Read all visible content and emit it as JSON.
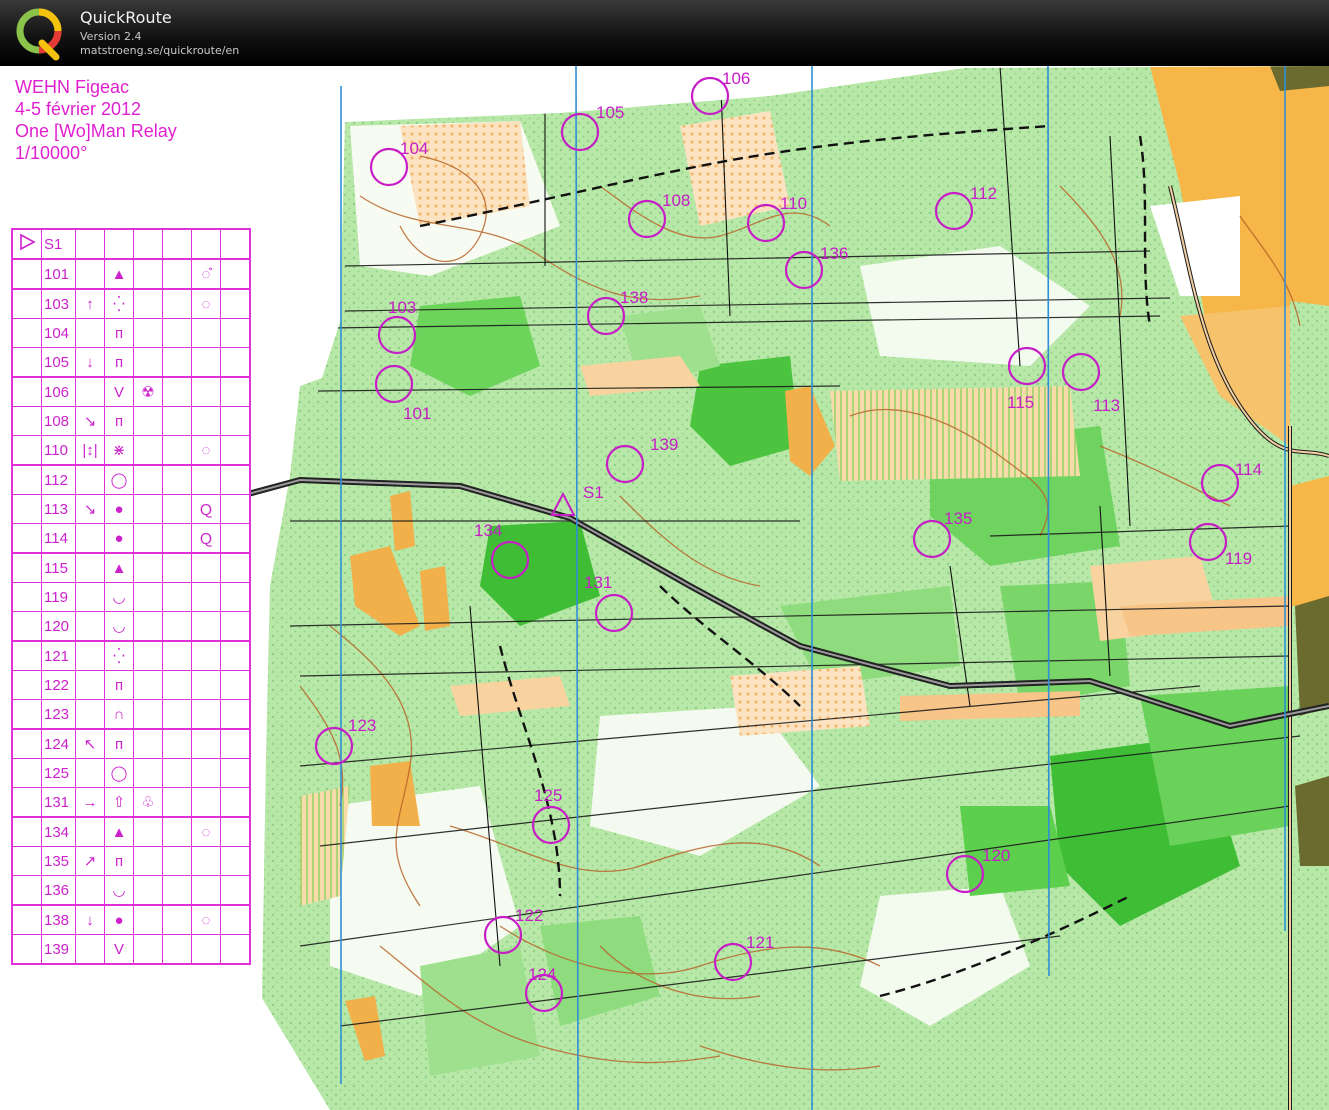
{
  "app": {
    "name": "QuickRoute",
    "version": "Version 2.4",
    "url": "matstroeng.se/quickroute/en"
  },
  "event": {
    "title": "WEHN Figeac",
    "dates": "4-5 février 2012",
    "race": "One [Wo]Man Relay",
    "scale": "1/10000°"
  },
  "colors": {
    "course": "#c71dc7",
    "meridian": "#2f8fd6",
    "vegetation_green": "#5ccf4c",
    "open_land": "#f6c587",
    "road": "#3a2a1a",
    "contour": "#b9652a"
  },
  "description_table": {
    "start_symbol": "start-triangle",
    "start_code": "S1",
    "rows": [
      {
        "code": "101",
        "dir": "",
        "feature": "▲",
        "extra": "",
        "pos": "◌̊"
      },
      {
        "code": "103",
        "dir": "↑",
        "feature": "⁛",
        "extra": "",
        "pos": "◌"
      },
      {
        "code": "104",
        "dir": "",
        "feature": "ᴨ",
        "extra": "",
        "pos": ""
      },
      {
        "code": "105",
        "dir": "↓",
        "feature": "ᴨ",
        "extra": "",
        "pos": ""
      },
      {
        "code": "106",
        "dir": "",
        "feature": "V",
        "extra": "☢",
        "pos": ""
      },
      {
        "code": "108",
        "dir": "↘",
        "feature": "ᴨ",
        "extra": "",
        "pos": ""
      },
      {
        "code": "110",
        "dir": "|↕|",
        "feature": "⋇",
        "extra": "",
        "pos": "◌"
      },
      {
        "code": "112",
        "dir": "",
        "feature": "◯",
        "extra": "",
        "pos": ""
      },
      {
        "code": "113",
        "dir": "↘",
        "feature": "●",
        "extra": "",
        "pos": "Ｑ"
      },
      {
        "code": "114",
        "dir": "",
        "feature": "●",
        "extra": "",
        "pos": "Ｑ"
      },
      {
        "code": "115",
        "dir": "",
        "feature": "▲",
        "extra": "",
        "pos": ""
      },
      {
        "code": "119",
        "dir": "",
        "feature": "◡",
        "extra": "",
        "pos": ""
      },
      {
        "code": "120",
        "dir": "",
        "feature": "◡",
        "extra": "",
        "pos": ""
      },
      {
        "code": "121",
        "dir": "",
        "feature": "⁛",
        "extra": "",
        "pos": ""
      },
      {
        "code": "122",
        "dir": "",
        "feature": "ᴨ",
        "extra": "",
        "pos": ""
      },
      {
        "code": "123",
        "dir": "",
        "feature": "∩",
        "extra": "",
        "pos": ""
      },
      {
        "code": "124",
        "dir": "↖",
        "feature": "ᴨ",
        "extra": "",
        "pos": ""
      },
      {
        "code": "125",
        "dir": "",
        "feature": "◯",
        "extra": "",
        "pos": ""
      },
      {
        "code": "131",
        "dir": "→",
        "feature": "⇧",
        "extra": "♧",
        "pos": ""
      },
      {
        "code": "134",
        "dir": "",
        "feature": "▲",
        "extra": "",
        "pos": "◌"
      },
      {
        "code": "135",
        "dir": "↗",
        "feature": "ᴨ",
        "extra": "",
        "pos": ""
      },
      {
        "code": "136",
        "dir": "",
        "feature": "◡",
        "extra": "",
        "pos": ""
      },
      {
        "code": "138",
        "dir": "↓",
        "feature": "●",
        "extra": "",
        "pos": "◌"
      },
      {
        "code": "139",
        "dir": "",
        "feature": "V",
        "extra": "",
        "pos": ""
      }
    ]
  },
  "controls": [
    {
      "code": "106"
    },
    {
      "code": "105"
    },
    {
      "code": "104"
    },
    {
      "code": "108"
    },
    {
      "code": "110"
    },
    {
      "code": "112"
    },
    {
      "code": "136"
    },
    {
      "code": "138"
    },
    {
      "code": "103"
    },
    {
      "code": "101"
    },
    {
      "code": "115"
    },
    {
      "code": "113"
    },
    {
      "code": "139"
    },
    {
      "code": "114"
    },
    {
      "code": "134"
    },
    {
      "code": "135"
    },
    {
      "code": "119"
    },
    {
      "code": "131"
    },
    {
      "code": "123"
    },
    {
      "code": "125"
    },
    {
      "code": "120"
    },
    {
      "code": "122"
    },
    {
      "code": "121"
    },
    {
      "code": "124"
    }
  ],
  "start": {
    "label": "S1"
  }
}
